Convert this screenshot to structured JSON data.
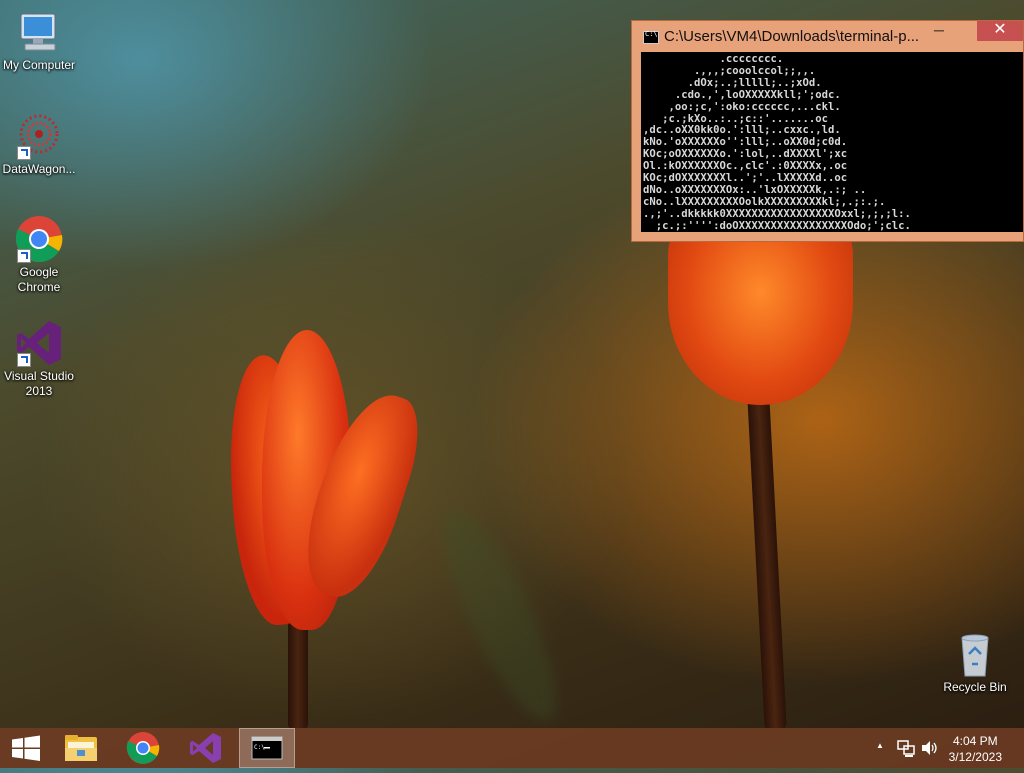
{
  "desktop": {
    "icons": [
      {
        "label": "My Computer"
      },
      {
        "label": "DataWagon..."
      },
      {
        "label": "Google Chrome"
      },
      {
        "label": "Visual Studio 2013"
      },
      {
        "label": "Recycle Bin"
      }
    ]
  },
  "terminal": {
    "title": "C:\\Users\\VM4\\Downloads\\terminal-p...",
    "minimize_glyph": "─",
    "close_glyph": "✕",
    "ascii_art": "            .cccccccc.\n        .,,,;cooolccol;;,,.\n       .dOx;..;lllll;..;xOd.\n     .cdo.,',loOXXXXXkll;';odc.\n    ,oo:;c,':oko:cccccc,...ckl.\n   ;c.;kXo..:..;c::'.......oc\n,dc..oXX0kk0o.':lll;..cxxc.,ld.\nkNo.'oXXXXXXo'':lll;..oXX0d;c0d.\nKOc;oOXXXXXXo.':lol,..dXXXXl';xc\nOl.:kOXXXXXXOc.,clc'.:0XXXXx,.oc\nKOc;dOXXXXXXXl..';'..lXXXXXd..oc\ndNo..oXXXXXXXOx:..'lxOXXXXXk,.:; ..\ncNo..lXXXXXXXXXOolkXXXXXXXXXkl;,.;:.;.\n.,;'..dkkkkk0XXXXXXXXXXXXXXXXXOxxl;,;,;l:.\n  ;c.;:'''':doOXXXXXXXXXXXXXXXXXOdo;';clc."
  },
  "taskbar": {
    "items": [
      {
        "name": "start"
      },
      {
        "name": "file-explorer"
      },
      {
        "name": "google-chrome"
      },
      {
        "name": "visual-studio"
      },
      {
        "name": "command-prompt"
      }
    ],
    "tray_chevron": "▲",
    "clock_time": "4:04 PM",
    "clock_date": "3/12/2023"
  },
  "colors": {
    "taskbar": "#6e3c23",
    "window_frame": "#e8a27a",
    "close_button": "#c75050"
  }
}
